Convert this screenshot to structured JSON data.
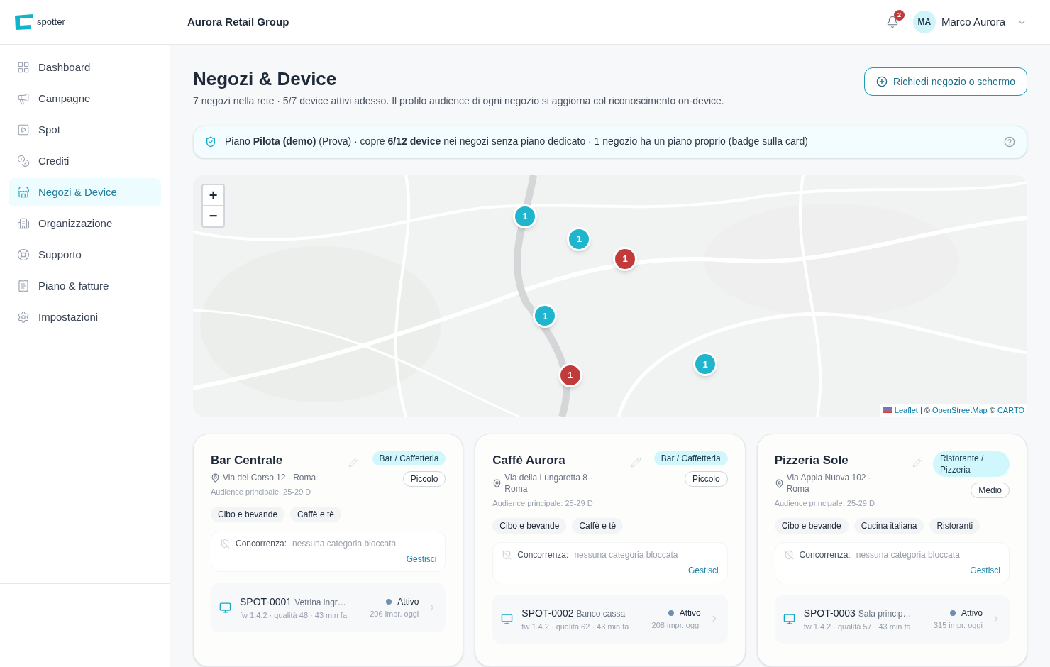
{
  "brand": {
    "name": "spotter"
  },
  "sidebar": {
    "items": [
      {
        "label": "Dashboard",
        "selected": false
      },
      {
        "label": "Campagne",
        "selected": false
      },
      {
        "label": "Spot",
        "selected": false
      },
      {
        "label": "Crediti",
        "selected": false
      },
      {
        "label": "Negozi & Device",
        "selected": true
      },
      {
        "label": "Organizzazione",
        "selected": false
      },
      {
        "label": "Supporto",
        "selected": false
      },
      {
        "label": "Piano & fatture",
        "selected": false
      },
      {
        "label": "Impostazioni",
        "selected": false
      }
    ]
  },
  "header": {
    "org": "Aurora Retail Group",
    "notifications": "2",
    "user": {
      "initials": "MA",
      "name": "Marco Aurora"
    }
  },
  "page": {
    "title": "Negozi & Device",
    "subtitle": "7 negozi nella rete · 5/7 device attivi adesso. Il profilo audience di ogni negozio si aggiorna col riconoscimento on-device.",
    "action": "Richiedi negozio o schermo"
  },
  "plan_banner": {
    "text": "Piano **Pilota (demo)** (Prova) · copre **6/12 device** nei negozi senza piano dedicato · 1 negozio ha un piano proprio (badge sulla card)"
  },
  "map": {
    "zoom_in": "+",
    "zoom_out": "−",
    "attribution": [
      {
        "text": "Leaflet",
        "kind": "link"
      },
      {
        "text": " | © ",
        "kind": "text"
      },
      {
        "text": "OpenStreetMap",
        "kind": "link"
      },
      {
        "text": " © ",
        "kind": "text"
      },
      {
        "text": "CARTO",
        "kind": "link"
      }
    ],
    "markers": [
      {
        "count": "1",
        "color": "#1fb5cc"
      },
      {
        "count": "1",
        "color": "#1fb5cc"
      },
      {
        "count": "1",
        "color": "#c23b3b"
      },
      {
        "count": "1",
        "color": "#1fb5cc"
      },
      {
        "count": "1",
        "color": "#1fb5cc"
      },
      {
        "count": "1",
        "color": "#c23b3b"
      }
    ]
  },
  "stores": [
    {
      "name": "Bar Centrale",
      "address": "Via del Corso 12 · Roma",
      "audience": "Audience principale: 25-29 D",
      "category": "Bar / Caffetteria",
      "size": "Piccolo",
      "tags": [
        "Cibo e bevande",
        "Caffè e tè"
      ],
      "competition": {
        "label": "Concorrenza:",
        "value": "nessuna categoria bloccata",
        "action": "Gestisci"
      },
      "device": {
        "id": "SPOT-0001",
        "location": "Vetrina ingr…",
        "meta": "fw 1.4.2 · qualità 48 · 43 min fa",
        "status": "Attivo",
        "color": "#6e8fb0",
        "impressions": "206 impr. oggi"
      }
    },
    {
      "name": "Caffè Aurora",
      "address": "Via della Lungaretta 8 · Roma",
      "audience": "Audience principale: 25-29 D",
      "category": "Bar / Caffetteria",
      "size": "Piccolo",
      "tags": [
        "Cibo e bevande",
        "Caffè e tè"
      ],
      "competition": {
        "label": "Concorrenza:",
        "value": "nessuna categoria bloccata",
        "action": "Gestisci"
      },
      "device": {
        "id": "SPOT-0002",
        "location": "Banco cassa",
        "meta": "fw 1.4.2 · qualità 62 · 43 min fa",
        "status": "Attivo",
        "color": "#6e8fb0",
        "impressions": "208 impr. oggi"
      }
    },
    {
      "name": "Pizzeria Sole",
      "address": "Via Appia Nuova 102 · Roma",
      "audience": "Audience principale: 25-29 D",
      "category": "Ristorante / Pizzeria",
      "size": "Medio",
      "tags": [
        "Cibo e bevande",
        "Cucina italiana",
        "Ristoranti"
      ],
      "competition": {
        "label": "Concorrenza:",
        "value": "nessuna categoria bloccata",
        "action": "Gestisci"
      },
      "device": {
        "id": "SPOT-0003",
        "location": "Sala princip…",
        "meta": "fw 1.4.2 · qualità 57 · 43 min fa",
        "status": "Attivo",
        "color": "#6e8fb0",
        "impressions": "315 impr. oggi"
      }
    }
  ]
}
